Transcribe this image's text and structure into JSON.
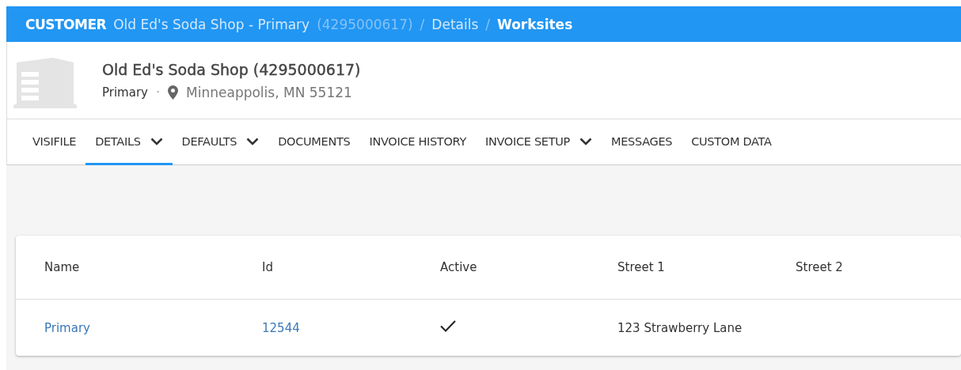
{
  "breadcrumb": {
    "section": "CUSTOMER",
    "customer": "Old Ed's Soda Shop - Primary",
    "customer_id": "(4295000617)",
    "separator_1": "/",
    "page": "Details",
    "separator_2": "/",
    "current": "Worksites"
  },
  "header": {
    "title": "Old Ed's Soda Shop (4295000617)",
    "subtitle": "Primary",
    "dot": "·",
    "location": "Minneappolis, MN 55121"
  },
  "tabs": [
    {
      "label": "VISIFILE",
      "selected": false,
      "dropdown": false
    },
    {
      "label": "DETAILS",
      "selected": true,
      "dropdown": true
    },
    {
      "label": "DEFAULTS",
      "selected": false,
      "dropdown": true
    },
    {
      "label": "DOCUMENTS",
      "selected": false,
      "dropdown": false
    },
    {
      "label": "INVOICE HISTORY",
      "selected": false,
      "dropdown": false
    },
    {
      "label": "INVOICE SETUP",
      "selected": false,
      "dropdown": true
    },
    {
      "label": "MESSAGES",
      "selected": false,
      "dropdown": false
    },
    {
      "label": "CUSTOM DATA",
      "selected": false,
      "dropdown": false
    }
  ],
  "table": {
    "columns": [
      "Name",
      "Id",
      "Active",
      "Street 1",
      "Street 2"
    ],
    "rows": [
      {
        "name": "Primary",
        "id": "12544",
        "active": true,
        "street_1": "123 Strawberry Lane"
      }
    ]
  }
}
